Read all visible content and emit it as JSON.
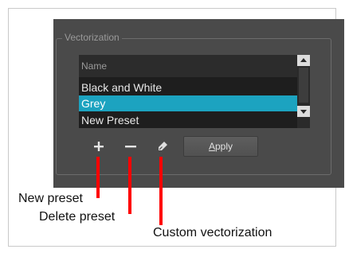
{
  "vectorization": {
    "group_title": "Vectorization",
    "list_header": "Name",
    "presets": [
      "Black and White",
      "Grey",
      "New Preset"
    ],
    "selected_preset": "Grey"
  },
  "toolbar": {
    "new_icon": "plus-icon",
    "delete_icon": "minus-icon",
    "custom_icon": "pen-icon",
    "apply_mnemonic": "A",
    "apply_rest": "pply"
  },
  "callouts": {
    "new_preset": "New preset",
    "delete_preset": "Delete preset",
    "custom_vectorization": "Custom vectorization"
  },
  "colors": {
    "panel": "#4a4a4a",
    "selection": "#1ca3c0",
    "callout_line": "#ff0000"
  }
}
